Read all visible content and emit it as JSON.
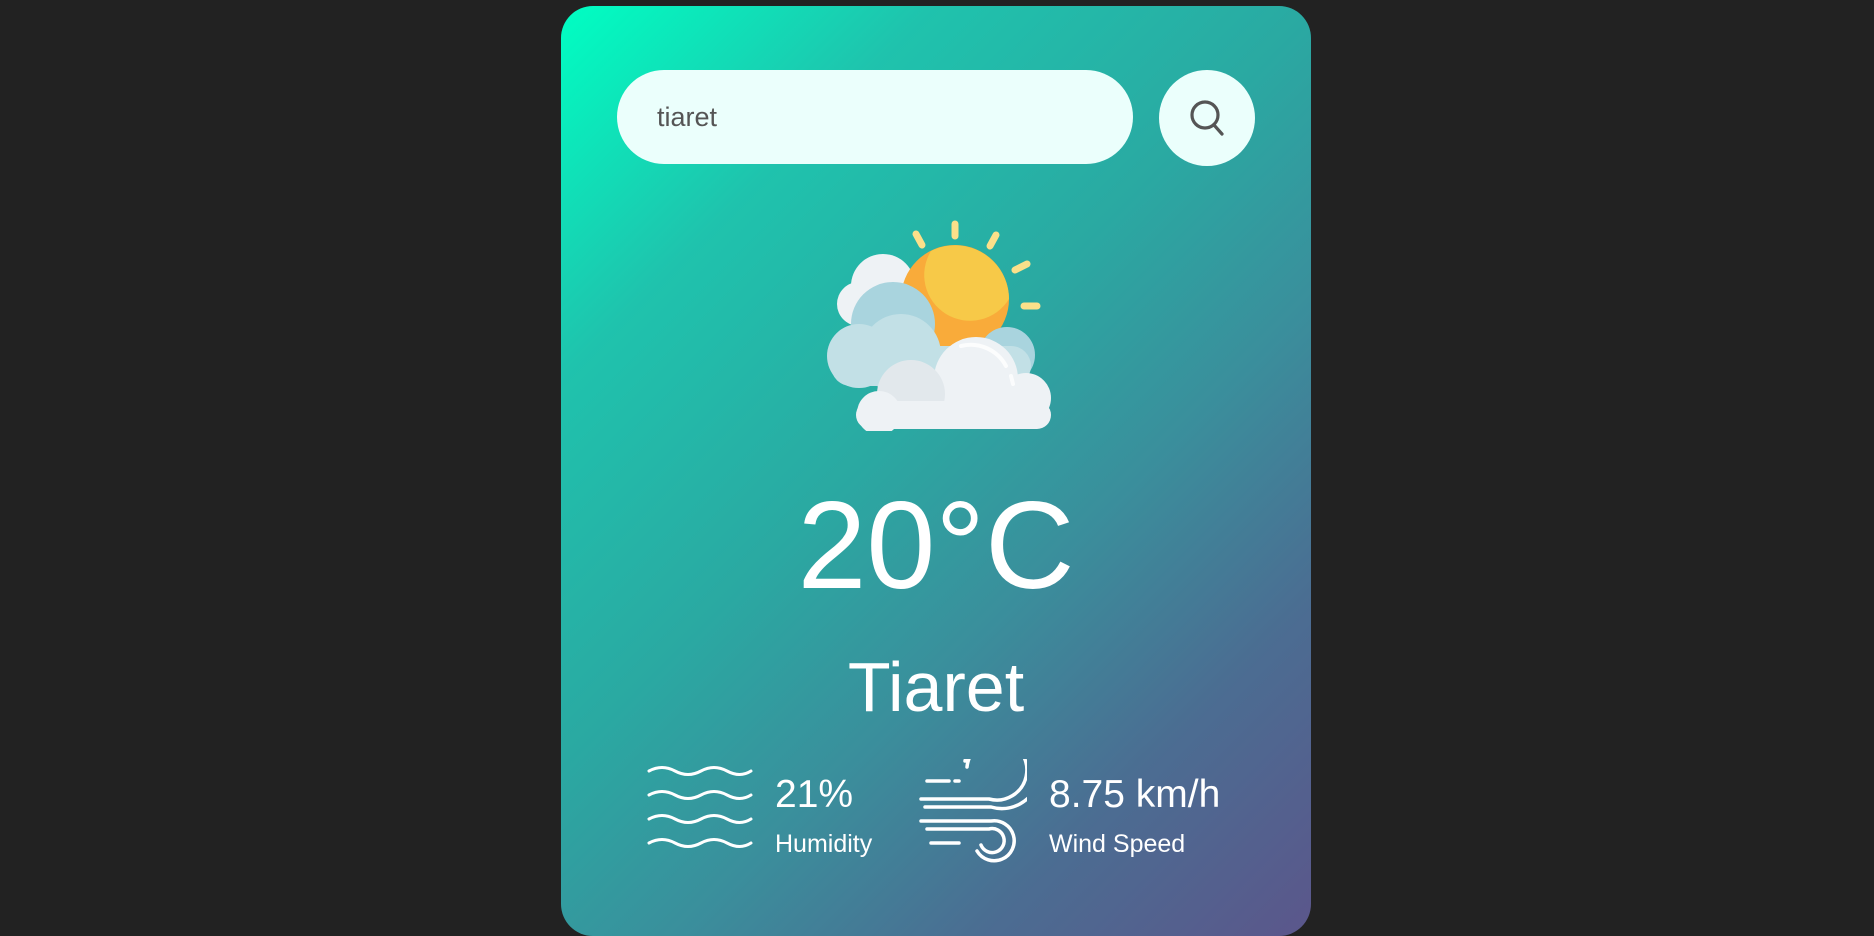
{
  "search": {
    "value": "tiaret",
    "placeholder": "",
    "button_icon": "search-icon"
  },
  "weather": {
    "icon": "partly-cloudy-icon",
    "temperature": "20°C",
    "city": "Tiaret"
  },
  "details": {
    "humidity": {
      "icon": "humidity-icon",
      "value": "21%",
      "label": "Humidity"
    },
    "wind": {
      "icon": "wind-icon",
      "value": "8.75 km/h",
      "label": "Wind Speed"
    }
  },
  "colors": {
    "background": "#222222",
    "gradient_start": "#00ffc3",
    "gradient_end": "#5b568b",
    "input_bg": "#ebfffc",
    "text": "#ffffff"
  }
}
